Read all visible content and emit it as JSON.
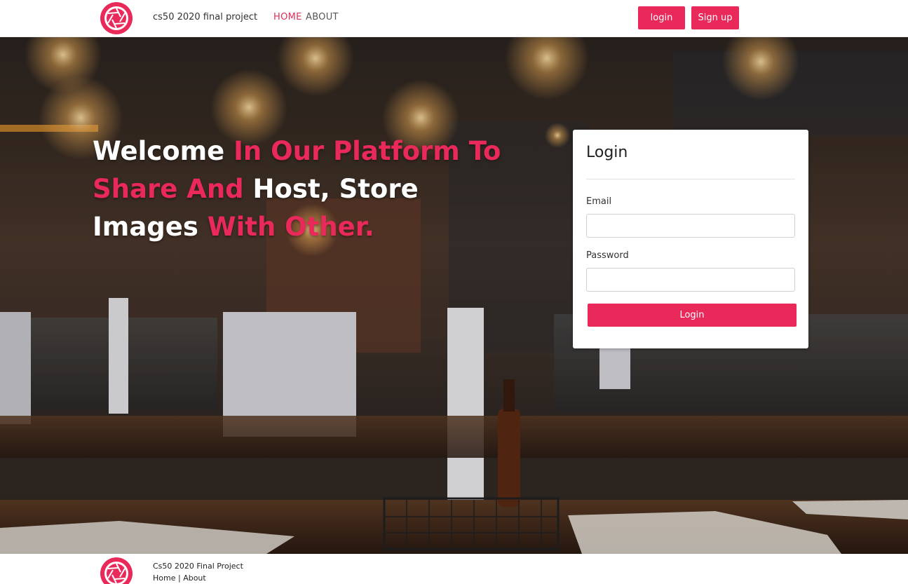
{
  "header": {
    "brand": "cs50 2020 final project",
    "nav": {
      "home": "HOME",
      "about": "ABOUT"
    },
    "buttons": {
      "login": "login",
      "signup": "Sign up"
    }
  },
  "hero": {
    "headline_1": "Welcome ",
    "headline_2": "In Our Platform To Share And ",
    "headline_3": "Host, Store Images ",
    "headline_4": "With Other."
  },
  "login_card": {
    "title": "Login",
    "email_label": "Email",
    "email_value": "",
    "password_label": "Password",
    "password_value": "",
    "submit": "Login"
  },
  "footer": {
    "title": "Cs50 2020 Final Project",
    "home": "Home",
    "separator": " | ",
    "about": "About"
  },
  "colors": {
    "accent": "#e8295a",
    "text": "#333333"
  },
  "icons": {
    "logo": "camera-aperture-icon"
  }
}
